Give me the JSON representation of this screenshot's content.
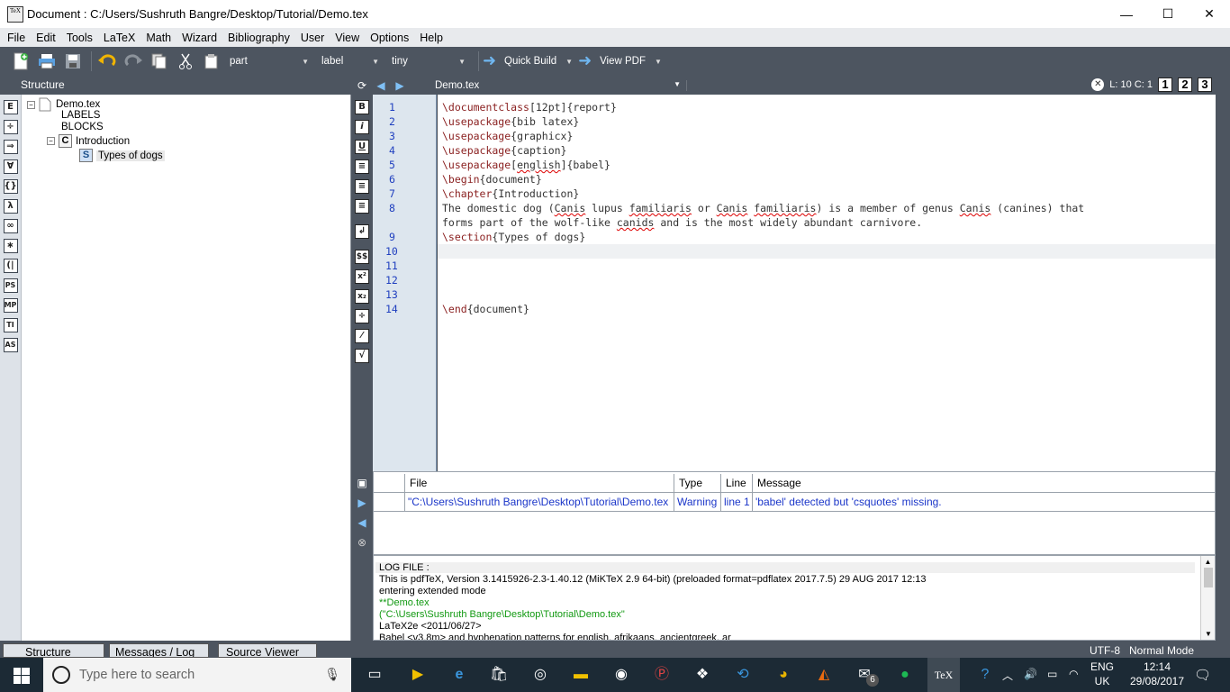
{
  "window": {
    "title": "Document : C:/Users/Sushruth Bangre/Desktop/Tutorial/Demo.tex",
    "logo_text": "TeX",
    "controls": [
      "—",
      "☐",
      "✕"
    ]
  },
  "menu": [
    "File",
    "Edit",
    "Tools",
    "LaTeX",
    "Math",
    "Wizard",
    "Bibliography",
    "User",
    "View",
    "Options",
    "Help"
  ],
  "toolbar": {
    "combo_part": "part",
    "combo_label": "label",
    "combo_size": "tiny",
    "quick_build": "Quick Build",
    "view_pdf": "View PDF"
  },
  "structure": {
    "header": "Structure",
    "root": "Demo.tex",
    "labels": "LABELS",
    "blocks": "BLOCKS",
    "chapter": "Introduction",
    "chapter_icon": "C",
    "section": "Types of dogs",
    "section_icon": "S",
    "side_icons": [
      "E",
      "÷",
      "⇒",
      "∀",
      "{}",
      "λ",
      "∞",
      "∗",
      "(|",
      "PS",
      "MP",
      "TI",
      "AS"
    ]
  },
  "editor": {
    "doc_name": "Demo.tex",
    "cursor_pos": "L: 10 C: 1",
    "view_nums": [
      "1",
      "2",
      "3"
    ],
    "format_icons": [
      "B",
      "i",
      "U",
      "≡",
      "≡",
      "≡",
      "↲",
      "$$",
      "x²",
      "x₂",
      "÷",
      "⁄",
      "√"
    ],
    "line_numbers": [
      "1",
      "2",
      "3",
      "4",
      "5",
      "6",
      "7",
      "8",
      "9",
      "10",
      "11",
      "12",
      "13",
      "14"
    ],
    "lines": {
      "l1_cmd": "\\documentclass",
      "l1_rest": "[12pt]{report}",
      "l2_cmd": "\\usepackage",
      "l2_rest": "{bib latex}",
      "l3_cmd": "\\usepackage",
      "l3_rest": "{graphicx}",
      "l4_cmd": "\\usepackage",
      "l4_rest": "{caption}",
      "l5_cmd": "\\usepackage",
      "l5_a": "[",
      "l5_sq": "english",
      "l5_b": "]{babel}",
      "l6_cmd": "\\begin",
      "l6_rest": "{document}",
      "l7_cmd": "\\chapter",
      "l7_rest": "{Introduction}",
      "l8a_1": "The domestic dog (",
      "l8a_2": "Canis",
      "l8a_3": " lupus ",
      "l8a_4": "familiaris",
      "l8a_5": " or ",
      "l8a_6": "Canis",
      "l8a_7": " ",
      "l8a_8": "familiaris",
      "l8a_9": ") is a member of genus ",
      "l8a_10": "Canis",
      "l8a_11": " (canines) that",
      "l8b_1": "forms part of the wolf-like ",
      "l8b_2": "canids",
      "l8b_3": " and is the most widely abundant carnivore.",
      "l9_cmd": "\\section",
      "l9_rest": "{Types of dogs}",
      "l14_cmd": "\\end",
      "l14_rest": "{document}"
    }
  },
  "messages": {
    "columns": [
      "File",
      "Type",
      "Line",
      "Message"
    ],
    "rows": [
      {
        "file": "\"C:\\Users\\Sushruth Bangre\\Desktop\\Tutorial\\Demo.tex",
        "type": "Warning",
        "line": "line 1",
        "message": "'babel' detected but 'csquotes' missing."
      }
    ]
  },
  "log": {
    "lines": [
      "LOG FILE :",
      "This is pdfTeX, Version 3.1415926-2.3-1.40.12 (MiKTeX 2.9 64-bit) (preloaded format=pdflatex 2017.7.5) 29 AUG 2017 12:13",
      "entering extended mode",
      "**Demo.tex",
      "(\"C:\\Users\\Sushruth Bangre\\Desktop\\Tutorial\\Demo.tex\"",
      "LaTeX2e <2011/06/27>",
      "Babel <v3.8m> and hyphenation patterns for english, afrikaans, ancientgreek, ar"
    ]
  },
  "bottom_tabs": [
    "Structure",
    "Messages / Log",
    "Source Viewer"
  ],
  "status": {
    "encoding": "UTF-8",
    "mode": "Normal Mode"
  },
  "taskbar": {
    "search_placeholder": "Type here to search",
    "lang_1": "ENG",
    "lang_2": "UK",
    "time": "12:14",
    "date": "29/08/2017",
    "mail_badge": "6"
  }
}
